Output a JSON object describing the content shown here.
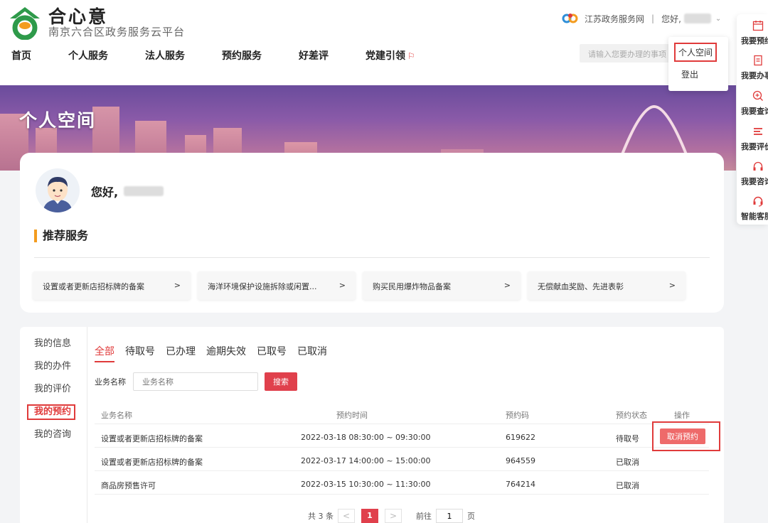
{
  "brand": {
    "name": "合心意",
    "subtitle": "南京六合区政务服务云平台"
  },
  "nav": [
    "首页",
    "个人服务",
    "法人服务",
    "预约服务",
    "好差评",
    "党建引领"
  ],
  "top_bar": {
    "portal": "江苏政务服务网",
    "greeting": "您好,"
  },
  "search": {
    "placeholder": "请输入您要办理的事项"
  },
  "user_menu": {
    "personal_space": "个人空间",
    "logout": "登出"
  },
  "banner": {
    "title": "个人空间"
  },
  "profile": {
    "greeting": "您好,"
  },
  "recommend": {
    "title": "推荐服务",
    "items": [
      {
        "label": "设置或者更新店招标牌的备案",
        "arrow": ">"
      },
      {
        "label": "海洋环境保护设施拆除或闲置...",
        "arrow": ">"
      },
      {
        "label": "购买民用爆炸物品备案",
        "arrow": ">"
      },
      {
        "label": "无偿献血奖励、先进表彰",
        "arrow": ">"
      }
    ]
  },
  "side_menu": [
    "我的信息",
    "我的办件",
    "我的评价",
    "我的预约",
    "我的咨询"
  ],
  "tabs": [
    "全部",
    "待取号",
    "已办理",
    "逾期失效",
    "已取号",
    "已取消"
  ],
  "filter": {
    "label": "业务名称",
    "placeholder": "业务名称",
    "button": "搜索"
  },
  "table": {
    "headers": [
      "业务名称",
      "预约时间",
      "预约码",
      "预约状态",
      "操作"
    ],
    "rows": [
      {
        "name": "设置或者更新店招标牌的备案",
        "time": "2022-03-18 08:30:00 ~ 09:30:00",
        "code": "619622",
        "status": "待取号",
        "action": "取消预约"
      },
      {
        "name": "设置或者更新店招标牌的备案",
        "time": "2022-03-17 14:00:00 ~ 15:00:00",
        "code": "964559",
        "status": "已取消",
        "action": ""
      },
      {
        "name": "商品房预售许可",
        "time": "2022-03-15 10:30:00 ~ 11:30:00",
        "code": "764214",
        "status": "已取消",
        "action": ""
      }
    ]
  },
  "pager": {
    "total": "共 3 条",
    "prev": "<",
    "page": "1",
    "next": ">",
    "goto": "前往",
    "goto_value": "1",
    "unit": "页"
  },
  "float_bar": [
    "我要预约",
    "我要办事",
    "我要查询",
    "我要评价",
    "我要咨询",
    "智能客服"
  ],
  "colors": {
    "accent": "#e0404c",
    "highlight_border": "#e03b3b",
    "orange_bar": "#f39c1f"
  }
}
